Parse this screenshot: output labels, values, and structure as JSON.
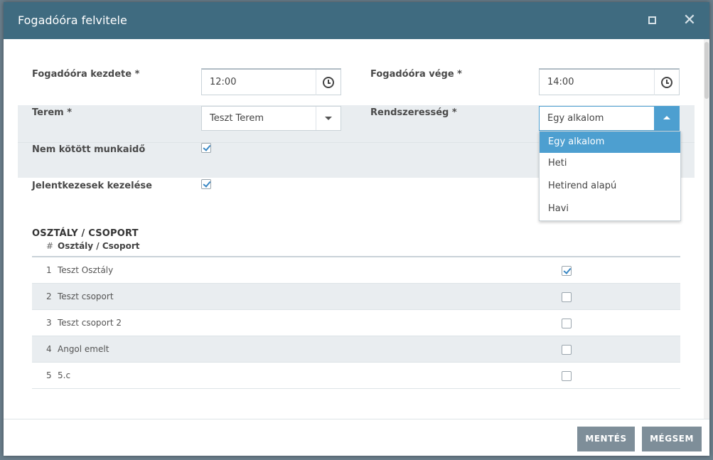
{
  "dialog": {
    "title": "Fogadóóra felvitele",
    "maximize_icon": "maximize-icon",
    "close_icon": "close-icon",
    "close_glyph": "✕"
  },
  "form": {
    "start_label": "Fogadóóra kezdete *",
    "start_value": "12:00",
    "end_label": "Fogadóóra vége *",
    "end_value": "14:00",
    "room_label": "Terem *",
    "room_value": "Teszt Terem",
    "recurrence_label": "Rendszeresség *",
    "recurrence_value": "Egy alkalom",
    "unbound_label": "Nem kötött munkaidő",
    "unbound_checked": true,
    "applications_label": "Jelentkezesek kezelése",
    "applications_checked": true
  },
  "recurrence_options": [
    {
      "label": "Egy alkalom",
      "selected": true
    },
    {
      "label": "Heti",
      "selected": false
    },
    {
      "label": "Hetirend alapú",
      "selected": false
    },
    {
      "label": "Havi",
      "selected": false
    }
  ],
  "groups": {
    "section_title": "OSZTÁLY / CSOPORT",
    "col_num": "#",
    "col_name": "Osztály / Csoport",
    "rows": [
      {
        "num": "1",
        "name": "Teszt Osztály",
        "checked": true
      },
      {
        "num": "2",
        "name": "Teszt csoport",
        "checked": false
      },
      {
        "num": "3",
        "name": "Teszt csoport 2",
        "checked": false
      },
      {
        "num": "4",
        "name": "Angol emelt",
        "checked": false
      },
      {
        "num": "5",
        "name": "5.c",
        "checked": false
      }
    ]
  },
  "footer": {
    "save_label": "MENTÉS",
    "cancel_label": "MÉGSEM"
  },
  "colors": {
    "titlebar": "#3f6b80",
    "accent": "#4d9fd0",
    "button": "#7e8e99",
    "band": "#e9edf0"
  }
}
